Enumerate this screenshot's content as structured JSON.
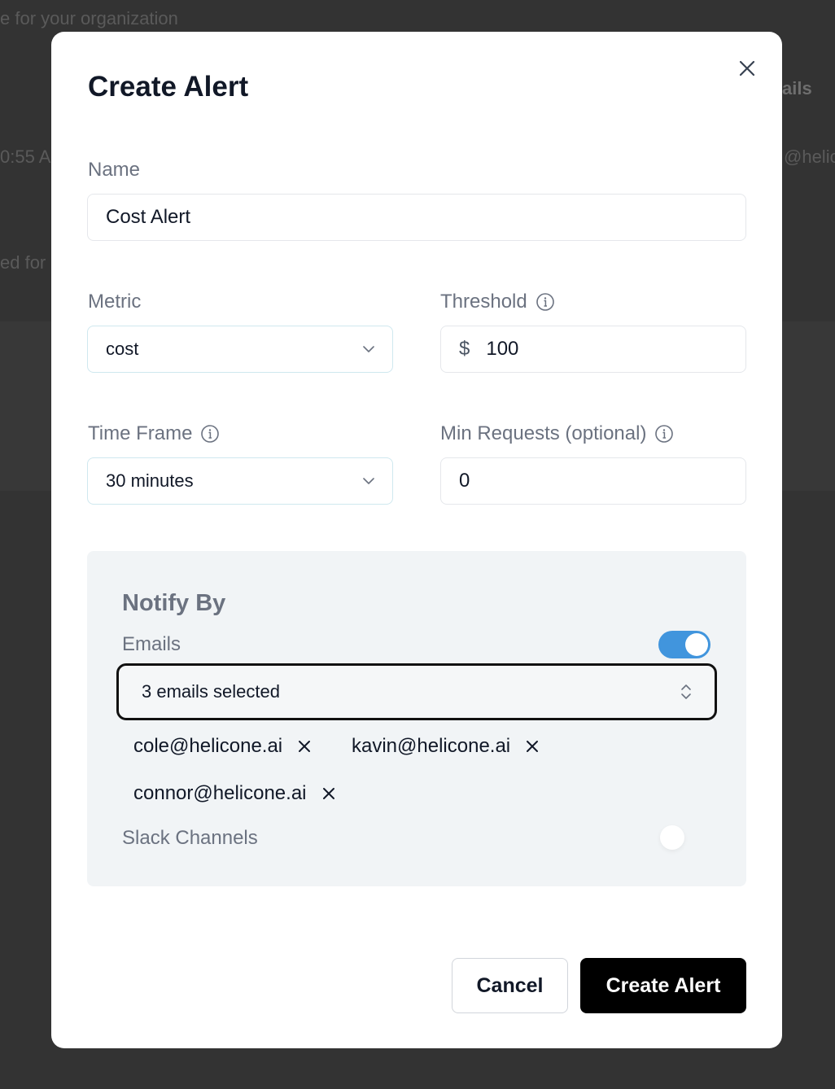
{
  "background": {
    "text_top": "e for your organization",
    "text_right_header": "ails",
    "text_time": "0:55 A",
    "text_email": "@helic",
    "text_left": "ed for"
  },
  "modal": {
    "title": "Create Alert",
    "close_icon": "close-icon",
    "name": {
      "label": "Name",
      "value": "Cost Alert"
    },
    "metric": {
      "label": "Metric",
      "value": "cost"
    },
    "threshold": {
      "label": "Threshold",
      "currency": "$",
      "value": "100"
    },
    "time_frame": {
      "label": "Time Frame",
      "value": "30 minutes"
    },
    "min_requests": {
      "label": "Min Requests (optional)",
      "value": "0"
    },
    "notify": {
      "title": "Notify By",
      "emails_label": "Emails",
      "emails_enabled": true,
      "emails_select": "3 emails selected",
      "emails": [
        "cole@helicone.ai",
        "kavin@helicone.ai",
        "connor@helicone.ai"
      ],
      "slack_label": "Slack Channels",
      "slack_enabled": false
    },
    "buttons": {
      "cancel": "Cancel",
      "create": "Create Alert"
    }
  },
  "colors": {
    "toggle_on": "#4195dd",
    "primary_button": "#000000",
    "overlay": "#333333"
  }
}
